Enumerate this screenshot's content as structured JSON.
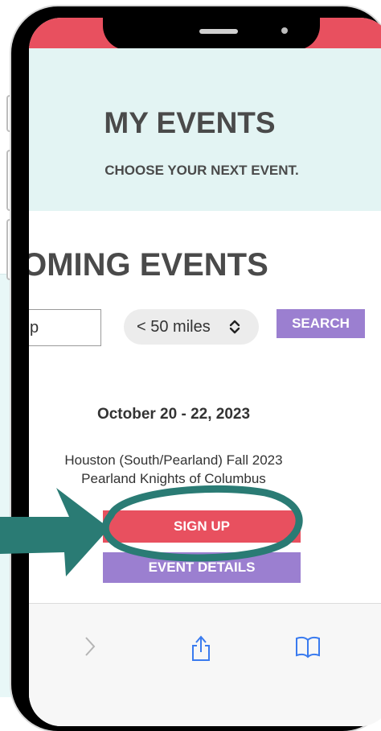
{
  "hero": {
    "title": "MY EVENTS",
    "subtitle": "CHOOSE YOUR NEXT EVENT."
  },
  "upcoming": {
    "heading": "COMING EVENTS"
  },
  "search": {
    "zip_value": "p",
    "radius_selected": "< 50 miles",
    "search_label": "SEARCH"
  },
  "event": {
    "date": "October 20 - 22, 2023",
    "title": "Houston (South/Pearland) Fall 2023",
    "venue": "Pearland Knights of Columbus",
    "signup_label": "SIGN UP",
    "details_label": "EVENT DETAILS"
  },
  "browser": {
    "icons": [
      "chevron-right-icon",
      "share-icon",
      "bookmarks-icon"
    ]
  },
  "colors": {
    "accent_red": "#e8505f",
    "accent_purple": "#9b7fd0",
    "hero_bg": "#e3f4f3",
    "annotation_teal": "#2a7b74"
  }
}
